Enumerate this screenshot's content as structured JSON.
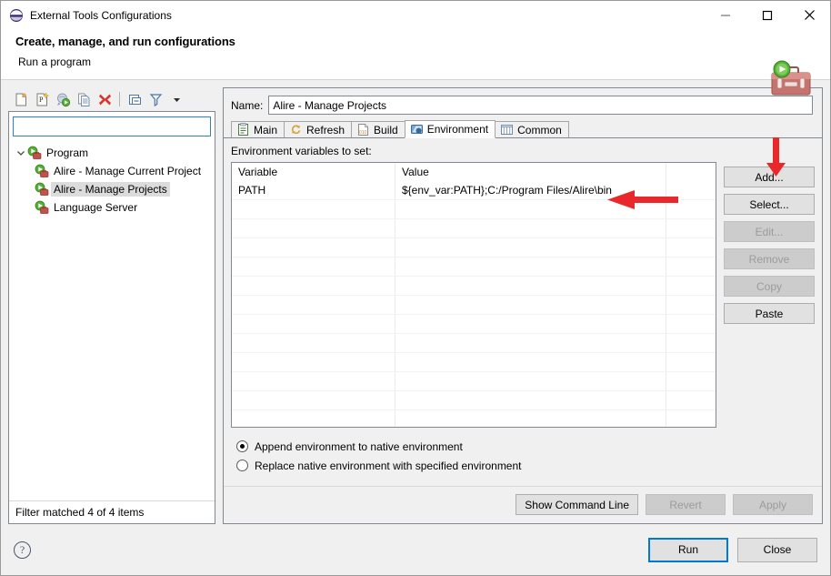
{
  "window": {
    "title": "External Tools Configurations",
    "title_icon": "eclipse-sphere-icon",
    "minimize_label": "Minimize",
    "maximize_label": "Maximize",
    "close_label": "Close"
  },
  "header": {
    "title": "Create, manage, and run configurations",
    "subtitle": "Run a program",
    "icon": "toolbox-run-icon"
  },
  "left_panel": {
    "toolbar": [
      {
        "name": "new-configuration-icon",
        "tooltip": "New launch configuration"
      },
      {
        "name": "new-prototype-icon",
        "tooltip": "New prototype"
      },
      {
        "name": "export-configuration-icon",
        "tooltip": "Export"
      },
      {
        "name": "duplicate-configuration-icon",
        "tooltip": "Duplicate"
      },
      {
        "name": "delete-configuration-icon",
        "tooltip": "Delete"
      },
      {
        "name": "collapse-all-icon",
        "tooltip": "Collapse All"
      },
      {
        "name": "filter-icon",
        "tooltip": "Filter"
      },
      {
        "name": "chevron-down-icon",
        "tooltip": "View Menu"
      }
    ],
    "filter": {
      "value": "",
      "placeholder": ""
    },
    "tree": [
      {
        "label": "Program",
        "level": 0,
        "expanded": true,
        "selected": false,
        "icon": "program-launch-icon"
      },
      {
        "label": "Alire - Manage Current Project",
        "level": 1,
        "expanded": false,
        "selected": false,
        "icon": "program-launch-icon"
      },
      {
        "label": "Alire - Manage Projects",
        "level": 1,
        "expanded": false,
        "selected": true,
        "icon": "program-launch-icon"
      },
      {
        "label": "Language Server",
        "level": 1,
        "expanded": false,
        "selected": false,
        "icon": "program-launch-icon"
      }
    ],
    "filter_status": "Filter matched 4 of 4 items"
  },
  "right_panel": {
    "name_label": "Name:",
    "name_value": "Alire - Manage Projects",
    "tabs": [
      {
        "label": "Main",
        "icon": "main-tab-icon",
        "active": false
      },
      {
        "label": "Refresh",
        "icon": "refresh-tab-icon",
        "active": false
      },
      {
        "label": "Build",
        "icon": "build-tab-icon",
        "active": false
      },
      {
        "label": "Environment",
        "icon": "environment-tab-icon",
        "active": true
      },
      {
        "label": "Common",
        "icon": "common-tab-icon",
        "active": false
      }
    ],
    "section_label": "Environment variables to set:",
    "table": {
      "columns": [
        "Variable",
        "Value"
      ],
      "rows": [
        {
          "variable": "PATH",
          "value": "${env_var:PATH};C:/Program Files/Alire\\bin"
        }
      ],
      "empty_row_count": 12
    },
    "side_buttons": [
      {
        "label": "Add...",
        "enabled": true
      },
      {
        "label": "Select...",
        "enabled": true
      },
      {
        "label": "Edit...",
        "enabled": false
      },
      {
        "label": "Remove",
        "enabled": false
      },
      {
        "label": "Copy",
        "enabled": false
      },
      {
        "label": "Paste",
        "enabled": true
      }
    ],
    "radios": [
      {
        "label": "Append environment to native environment",
        "checked": true
      },
      {
        "label": "Replace native environment with specified environment",
        "checked": false
      }
    ],
    "footer_buttons": [
      {
        "label": "Show Command Line",
        "enabled": true
      },
      {
        "label": "Revert",
        "enabled": false
      },
      {
        "label": "Apply",
        "enabled": false
      }
    ]
  },
  "dialog_footer": {
    "help_icon": "help-question-icon",
    "help_glyph": "?",
    "buttons": [
      {
        "label": "Run",
        "primary": true
      },
      {
        "label": "Close",
        "primary": false
      }
    ]
  },
  "annotations": [
    {
      "name": "add-button-arrow",
      "direction": "down",
      "color": "#e8282a"
    },
    {
      "name": "path-value-arrow",
      "direction": "left",
      "color": "#e8282a"
    }
  ],
  "colors": {
    "accent": "#0078d7",
    "annotation": "#e8282a",
    "dialog_bg": "#f0f0f0",
    "field_bg": "#ffffff"
  }
}
